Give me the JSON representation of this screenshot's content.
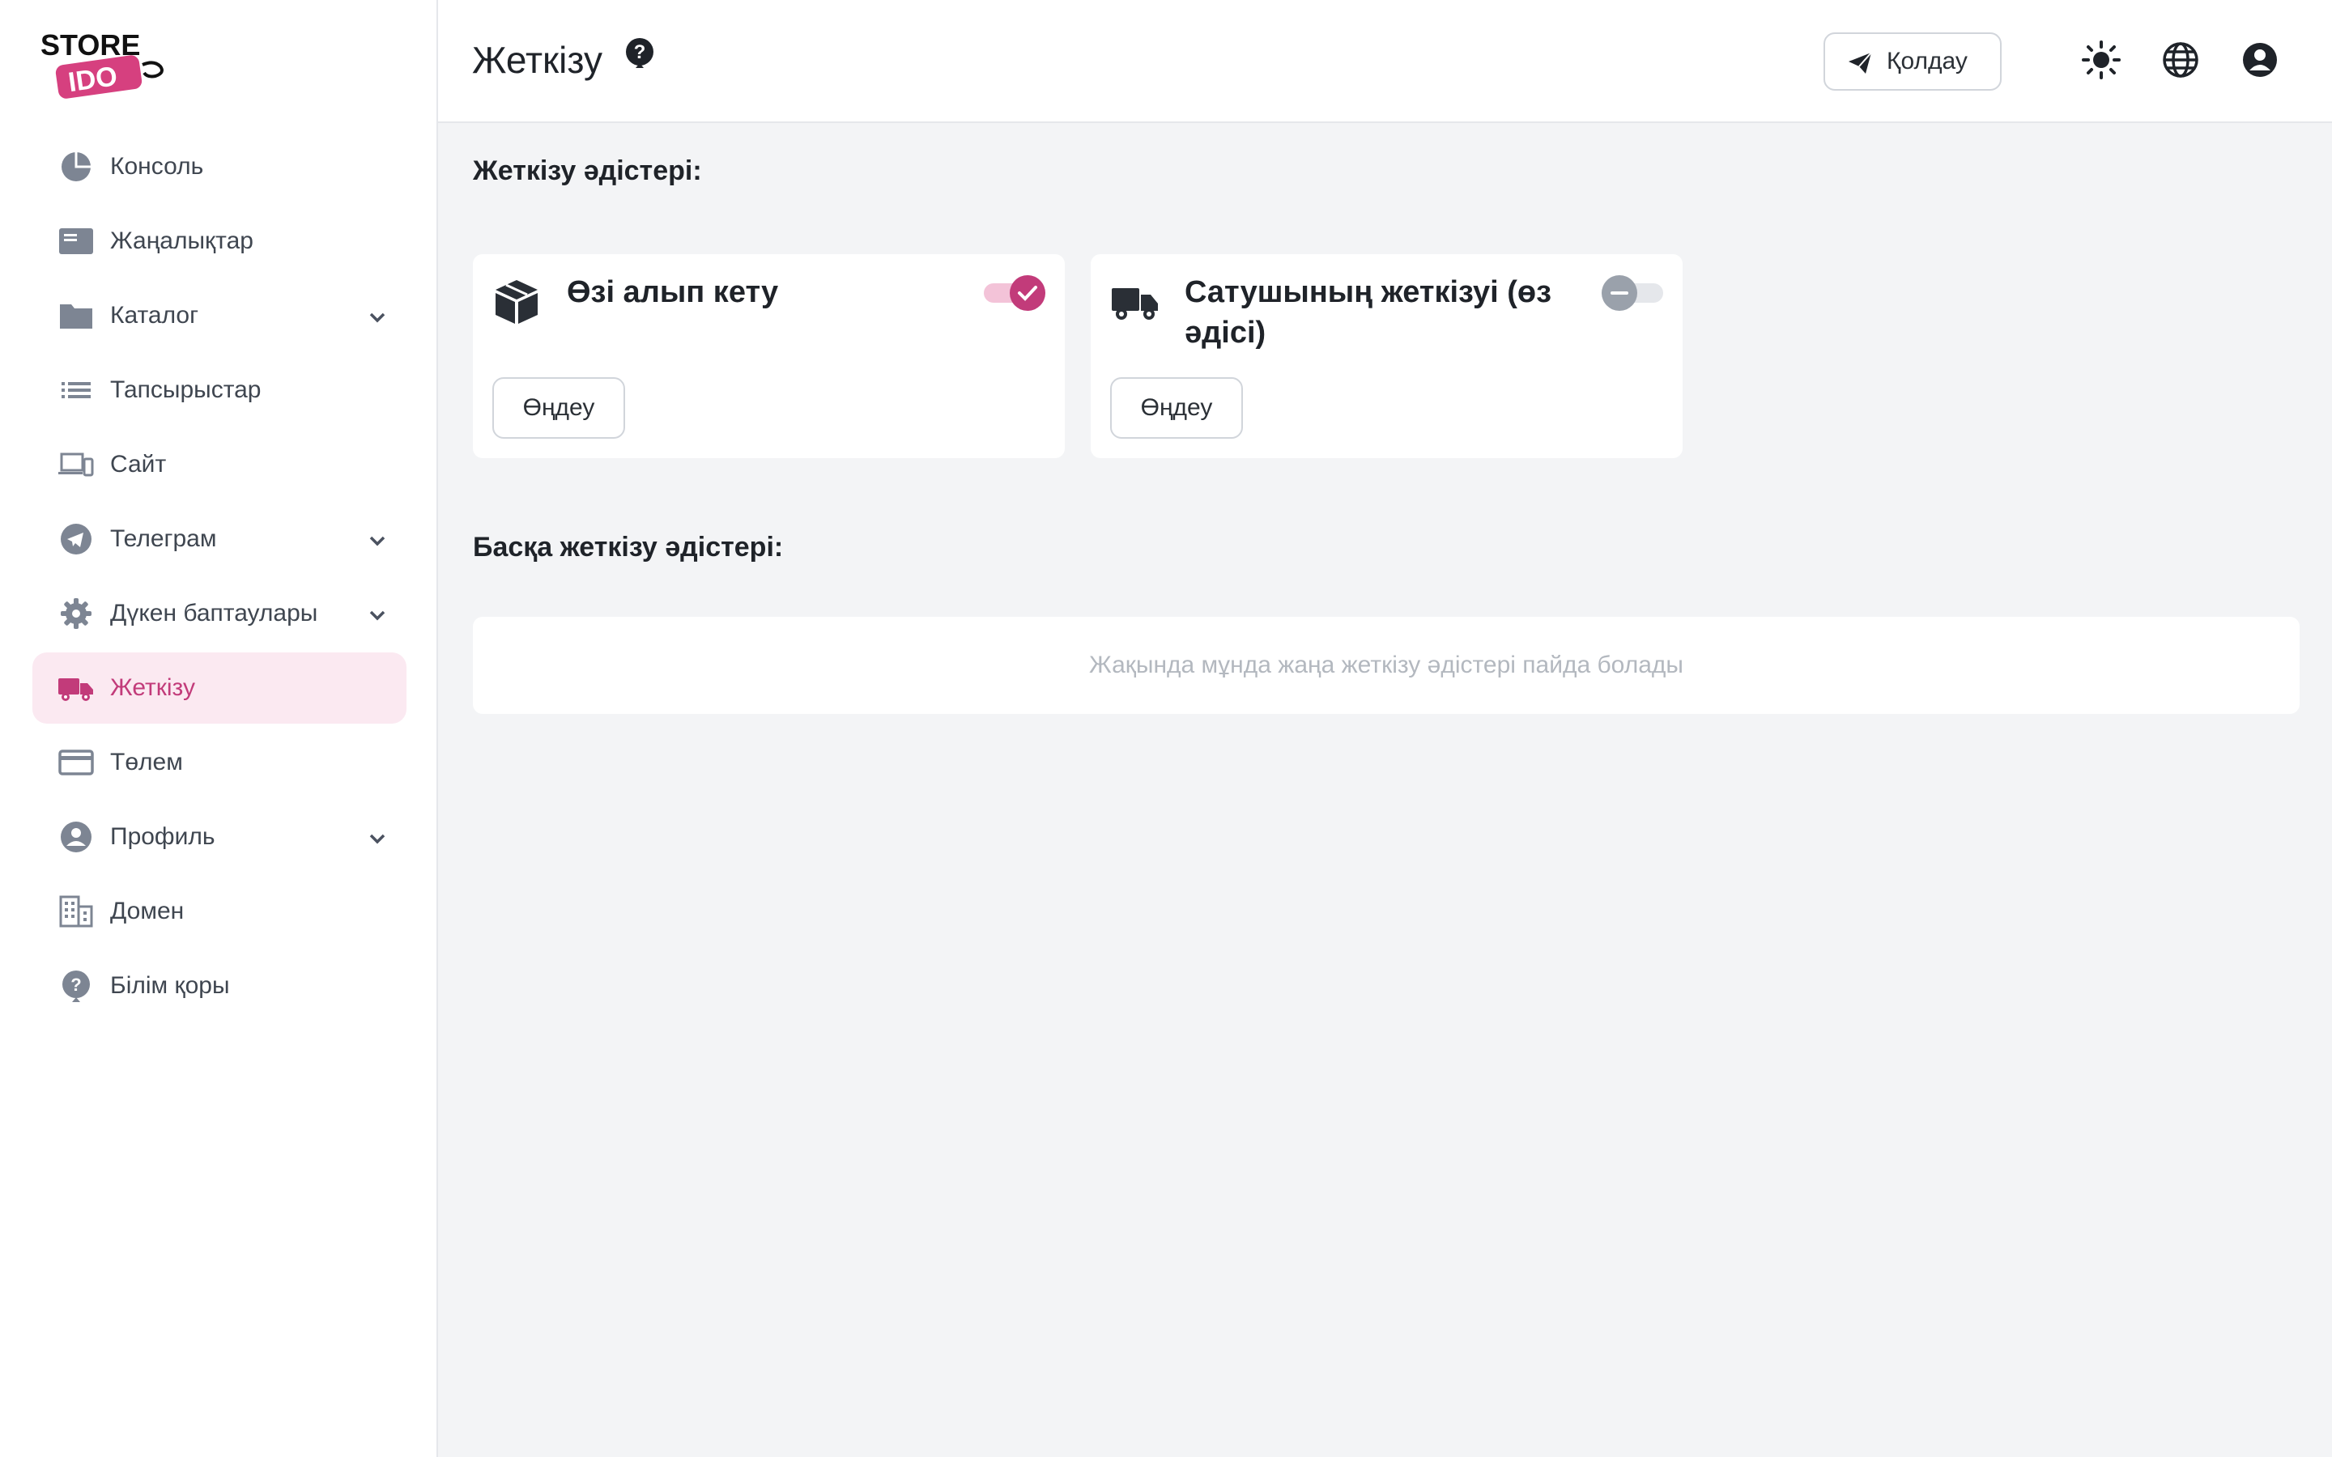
{
  "brand": {
    "logo_line1": "STORE",
    "logo_line2": "IDO",
    "accent_color": "#c23b7a"
  },
  "sidebar": {
    "items": [
      {
        "label": "Консоль",
        "icon": "pie-chart-icon",
        "has_submenu": false,
        "active": false
      },
      {
        "label": "Жаңалықтар",
        "icon": "newspaper-icon",
        "has_submenu": false,
        "active": false
      },
      {
        "label": "Каталог",
        "icon": "folder-icon",
        "has_submenu": true,
        "active": false
      },
      {
        "label": "Тапсырыстар",
        "icon": "list-icon",
        "has_submenu": false,
        "active": false
      },
      {
        "label": "Сайт",
        "icon": "devices-icon",
        "has_submenu": false,
        "active": false
      },
      {
        "label": "Телеграм",
        "icon": "telegram-icon",
        "has_submenu": true,
        "active": false
      },
      {
        "label": "Дүкен баптаулары",
        "icon": "gear-icon",
        "has_submenu": true,
        "active": false
      },
      {
        "label": "Жеткізу",
        "icon": "truck-icon",
        "has_submenu": false,
        "active": true
      },
      {
        "label": "Төлем",
        "icon": "credit-card-icon",
        "has_submenu": false,
        "active": false
      },
      {
        "label": "Профиль",
        "icon": "user-circle-icon",
        "has_submenu": true,
        "active": false
      },
      {
        "label": "Домен",
        "icon": "building-icon",
        "has_submenu": false,
        "active": false
      },
      {
        "label": "Білім қоры",
        "icon": "question-icon",
        "has_submenu": false,
        "active": false
      }
    ]
  },
  "header": {
    "title": "Жеткізу",
    "support_label": "Қолдау"
  },
  "main": {
    "methods_title": "Жеткізу әдістері:",
    "methods": [
      {
        "title": "Өзі алып кету",
        "icon": "box-icon",
        "enabled": true,
        "edit_label": "Өңдеу"
      },
      {
        "title": "Сатушының жеткізуі (өз әдісі)",
        "icon": "truck-icon",
        "enabled": false,
        "edit_label": "Өңдеу"
      }
    ],
    "other_title": "Басқа жеткізу әдістері:",
    "other_empty_text": "Жақында мұнда жаңа жеткізу әдістері пайда болады"
  }
}
